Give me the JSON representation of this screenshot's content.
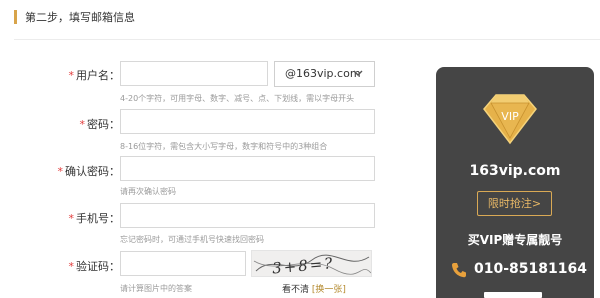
{
  "header": {
    "step_title": "第二步，填写邮箱信息"
  },
  "form": {
    "username": {
      "label": "用户名：",
      "value": "",
      "hint": "4-20个字符，可用字母、数字、减号、点、下划线，需以字母开头"
    },
    "domain_select": {
      "value": "@163vip.com"
    },
    "password": {
      "label": "密码：",
      "value": "",
      "hint": "8-16位字符，需包含大小写字母，数字和符号中的3种组合"
    },
    "confirm_password": {
      "label": "确认密码：",
      "value": "",
      "hint": "请再次确认密码"
    },
    "phone": {
      "label": "手机号：",
      "value": "",
      "hint": "忘记密码时，可通过手机号快速找回密码"
    },
    "captcha": {
      "label": "验证码：",
      "value": "",
      "hint": "请计算图片中的答案",
      "image_text": "3+8=?",
      "refresh_prefix": "看不清",
      "refresh_link": "[换一张]"
    },
    "required_mark": "*"
  },
  "promo": {
    "badge_text": "VIP",
    "domain": "163vip.com",
    "cta": "限时抢注>",
    "slogan": "买VIP赠专属靓号",
    "phone": "010-85181164"
  },
  "colors": {
    "accent_gold": "#d9a955",
    "required_red": "#e23b3b",
    "promo_bg": "#454545"
  },
  "icons": [
    "chevron-down-icon",
    "diamond-icon",
    "phone-icon"
  ]
}
